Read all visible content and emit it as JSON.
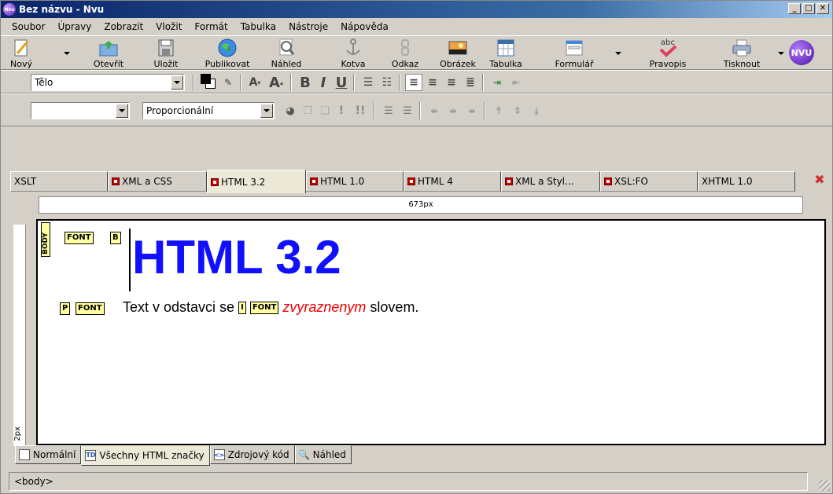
{
  "window": {
    "title": "Bez názvu - Nvu",
    "logo": "Nvu"
  },
  "menu": [
    "Soubor",
    "Úpravy",
    "Zobrazit",
    "Vložit",
    "Formát",
    "Tabulka",
    "Nástroje",
    "Nápověda"
  ],
  "toolbar": {
    "buttons": [
      "Nový",
      "Otevřít",
      "Uložit",
      "Publikovat",
      "Náhled",
      "Kotva",
      "Odkaz",
      "Obrázek",
      "Tabulka",
      "Formulář",
      "Pravopis",
      "Tisknout"
    ],
    "nvu_badge": "NVU",
    "spell_abc": "abc"
  },
  "format": {
    "paragraph_style": "Tělo",
    "font_face": "Proporcionální",
    "bold": "B",
    "italic": "I",
    "underline": "U",
    "font_small": "A",
    "font_large": "A"
  },
  "tabs": [
    "XSLT",
    "XML a CSS",
    "HTML 3.2",
    "HTML 1.0",
    "HTML 4",
    "XML a Styl...",
    "XSL:FO",
    "XHTML 1.0"
  ],
  "ruler": {
    "width_label": "673px",
    "height_label": "2px"
  },
  "editor": {
    "tags": {
      "body": "BODY",
      "font1": "FONT",
      "b": "B",
      "p": "P",
      "font2": "FONT",
      "i": "I",
      "font3": "FONT"
    },
    "heading": "HTML 3.2",
    "para_before": "Text v odstavci se",
    "para_em": "zvyraznenym",
    "para_after": "slovem."
  },
  "viewtabs": [
    "Normální",
    "Všechny HTML značky",
    "Zdrojový kód",
    "Náhled"
  ],
  "viewicons": {
    "all_tags": "TD"
  },
  "status": "<body>"
}
